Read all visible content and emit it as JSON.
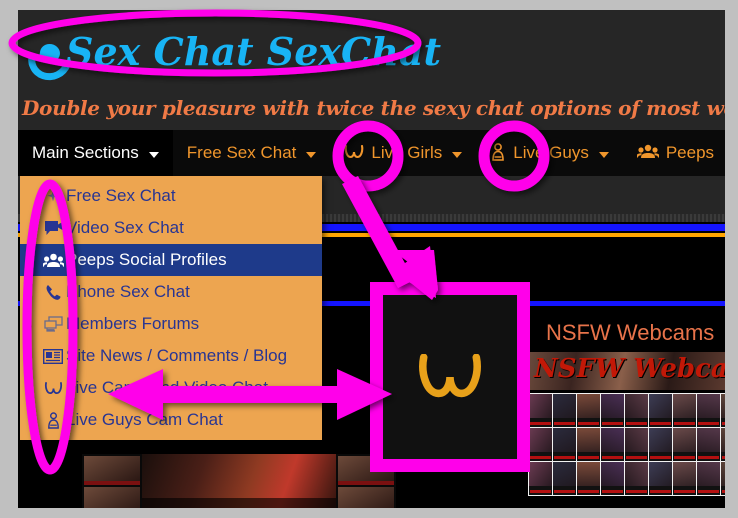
{
  "site": {
    "logo_text": "Sex Chat SexChat",
    "logo_icon": "chat-bubble-logo-icon",
    "tagline": "Double your pleasure with twice the sexy chat options of most web sites!"
  },
  "navbar": {
    "items": [
      {
        "label": "Main Sections",
        "icon": "",
        "caret": true,
        "active": true
      },
      {
        "label": "Free Sex Chat",
        "icon": "",
        "caret": true,
        "active": false
      },
      {
        "label": "Live Girls",
        "icon": "breasts-icon",
        "caret": true,
        "active": false
      },
      {
        "label": "Live Guys",
        "icon": "male-torso-icon",
        "caret": true,
        "active": false
      },
      {
        "label": "Peeps",
        "icon": "people-group-icon",
        "caret": false,
        "active": false
      }
    ]
  },
  "dropdown": {
    "owner": "Main Sections",
    "items": [
      {
        "label": "Free Sex Chat",
        "icon": "sparkle-icon",
        "selected": false
      },
      {
        "label": "Video Sex Chat",
        "icon": "video-chat-icon",
        "selected": false
      },
      {
        "label": "Peeps Social Profiles",
        "icon": "people-group-icon",
        "selected": true
      },
      {
        "label": "Phone Sex Chat",
        "icon": "phone-icon",
        "selected": false
      },
      {
        "label": "Members Forums",
        "icon": "forum-icon",
        "selected": false
      },
      {
        "label": "Site News / Comments / Blog",
        "icon": "newspaper-icon",
        "selected": false
      },
      {
        "label": "Live Cams and Video Chat",
        "icon": "breasts-icon",
        "selected": false
      },
      {
        "label": "Live Guys Cam Chat",
        "icon": "male-torso-icon",
        "selected": false
      }
    ]
  },
  "nsfw_panel": {
    "title": "NSFW Webcams",
    "banner_text": "NSFW Webcams",
    "thumbnail_count": 27
  },
  "callout": {
    "label": "magnified-live-girls-icon",
    "icon": "breasts-icon"
  },
  "annotations": {
    "logo_ellipse": "magenta-ellipse-around-logo",
    "nav_circle_live_girls": "magenta-circle-around-live-girls-icon",
    "nav_circle_live_guys": "magenta-circle-around-live-guys-icon",
    "menu_ellipse": "magenta-ellipse-around-dropdown-icons",
    "arrow_to_callout": "magenta-arrow-from-live-girls-icon-to-callout",
    "double_arrow": "magenta-double-headed-arrow-menu-to-callout"
  },
  "colors": {
    "accent_magenta": "#ff00ea",
    "menu_orange": "#eda550",
    "menu_text_blue": "#283593",
    "menu_selected_blue": "#1e3a8a",
    "nav_orange": "#f0962c",
    "logo_blue": "#18b4f5",
    "tagline_orange": "#f07a46",
    "bar_blue": "#1414ff",
    "bar_orange": "#ffa500",
    "page_black": "#000000",
    "header_grey": "#262626",
    "chrome_grey": "#c0c0c0",
    "nsfw_title": "#e8734a",
    "nsfw_banner_red": "#c21807"
  }
}
